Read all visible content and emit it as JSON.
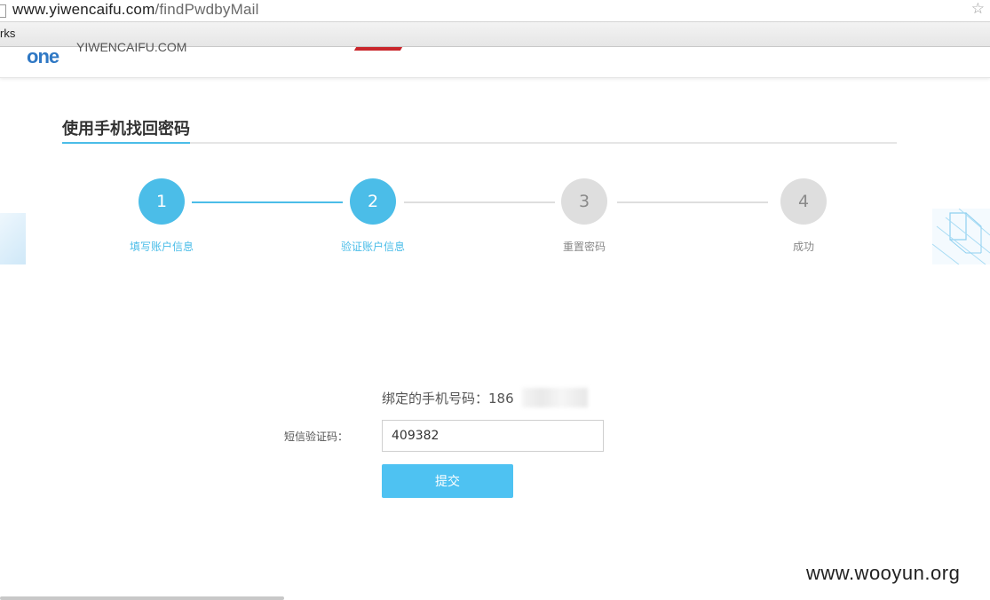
{
  "browser": {
    "url_host": "www.yiwencaifu.com",
    "url_path": "/findPwdbyMail",
    "bookmarks_label": "rks",
    "star_icon": "star-icon"
  },
  "site": {
    "logo_mark": "one",
    "logo_text": "YIWENCAIFU.COM"
  },
  "section": {
    "title": "使用手机找回密码"
  },
  "steps": [
    {
      "number": "1",
      "label": "填写账户信息",
      "state": "active"
    },
    {
      "number": "2",
      "label": "验证账户信息",
      "state": "active"
    },
    {
      "number": "3",
      "label": "重置密码",
      "state": "inactive"
    },
    {
      "number": "4",
      "label": "成功",
      "state": "inactive"
    }
  ],
  "form": {
    "phone_label": "绑定的手机号码：",
    "phone_prefix": "186",
    "sms_label": "短信验证码：",
    "sms_value": "409382",
    "submit_label": "提交"
  },
  "colors": {
    "accent": "#4bbde8",
    "button": "#4ec2f2",
    "inactive": "#dedede"
  },
  "watermark": "www.wooyun.org"
}
